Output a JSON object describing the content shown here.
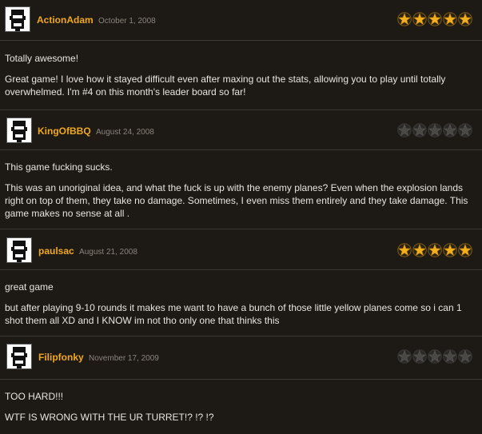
{
  "reviews": [
    {
      "user": "ActionAdam",
      "date": "October 1, 2008",
      "rating": 5,
      "title": "Totally awesome!",
      "text": "Great game! I love how it stayed difficult even after maxing out the stats, allowing you to play until totally overwhelmed. I'm #4 on this month's leader board so far!"
    },
    {
      "user": "KingOfBBQ",
      "date": "August 24, 2008",
      "rating": 0,
      "title": "This game fucking sucks.",
      "text": "This was an unoriginal idea, and what the fuck is up with the enemy planes? Even when the explosion lands right on top of them, they take no damage. Sometimes, I even miss them entirely and they take damage. This game makes no sense at all ."
    },
    {
      "user": "paulsac",
      "date": "August 21, 2008",
      "rating": 5,
      "title": "great game",
      "text": "but after playing 9-10 rounds it makes me want to have a bunch of those little yellow planes come so i can 1 shot them all XD and I KNOW im not tho only one that thinks this"
    },
    {
      "user": "Filipfonky",
      "date": "November 17, 2009",
      "rating": 0,
      "title": "TOO HARD!!!",
      "text": "WTF IS WRONG WITH THE UR TURRET!? !? !?"
    }
  ],
  "colors": {
    "background": "#1d1915",
    "username": "#f0a81c",
    "star_filled": "#f2b01e",
    "star_empty": "#4a4744"
  },
  "icons": {
    "avatar": "pixel-face-avatar-icon",
    "star": "star-icon"
  }
}
